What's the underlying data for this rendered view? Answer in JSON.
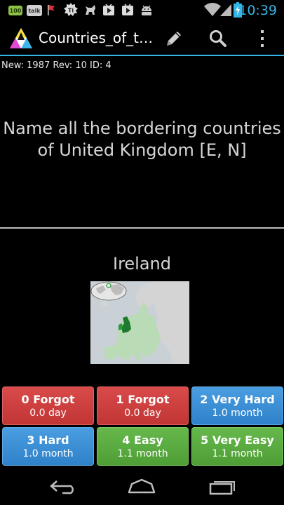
{
  "status_bar": {
    "time": "10:39",
    "badge_100": "100",
    "badge_talk": "talk",
    "badge_ti": "Ti",
    "icons": [
      "battery-100-icon",
      "talk-icon",
      "flag-icon",
      "ti-icon",
      "creature-icon",
      "play-store-icon",
      "play-store-icon",
      "android-icon",
      "wifi-icon",
      "signal-icon",
      "battery-icon"
    ]
  },
  "action_bar": {
    "title": "Countries_of_t…",
    "actions": [
      "edit-icon",
      "search-icon",
      "overflow-menu-icon"
    ]
  },
  "card": {
    "info": "New: 1987 Rev: 10 ID: 4",
    "question": "Name all the bordering countries of United Kingdom [E, N]",
    "answer": "Ireland"
  },
  "rating_buttons": [
    {
      "label": "0 Forgot",
      "interval": "0.0 day"
    },
    {
      "label": "1 Forgot",
      "interval": "0.0 day"
    },
    {
      "label": "2 Very Hard",
      "interval": "1.0 month"
    },
    {
      "label": "3 Hard",
      "interval": "1.0 month"
    },
    {
      "label": "4 Easy",
      "interval": "1.1 month"
    },
    {
      "label": "5 Very Easy",
      "interval": "1.1 month"
    }
  ],
  "colors": {
    "accent": "#33b5e5",
    "red_button": "#c94040",
    "blue_button": "#3a8fd4",
    "green_button": "#58a83f",
    "question_text": "#d6d6d6"
  }
}
